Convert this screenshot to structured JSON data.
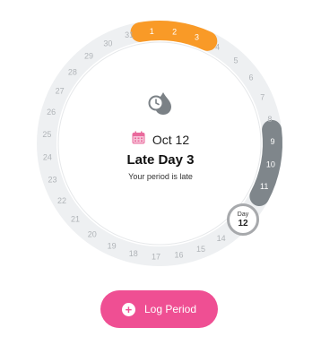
{
  "colors": {
    "ring_track": "#eef0f2",
    "period_arc": "#f99a27",
    "predicted_arc": "#7f868b",
    "ring_text": "#b0b4b8",
    "button": "#ef4f93"
  },
  "cycle": {
    "total_days": 31,
    "period_days": [
      1,
      2,
      3
    ],
    "predicted_days": [
      9,
      10,
      11
    ],
    "today_day": 12
  },
  "center": {
    "drop_icon": "clock-drop-icon",
    "calendar_icon": "calendar-icon",
    "date_label": "Oct 12",
    "status_title": "Late Day 3",
    "status_subtitle": "Your period is late"
  },
  "today_marker": {
    "label": "Day",
    "day": "12"
  },
  "log_button": {
    "icon": "plus-icon",
    "label": "Log Period"
  }
}
